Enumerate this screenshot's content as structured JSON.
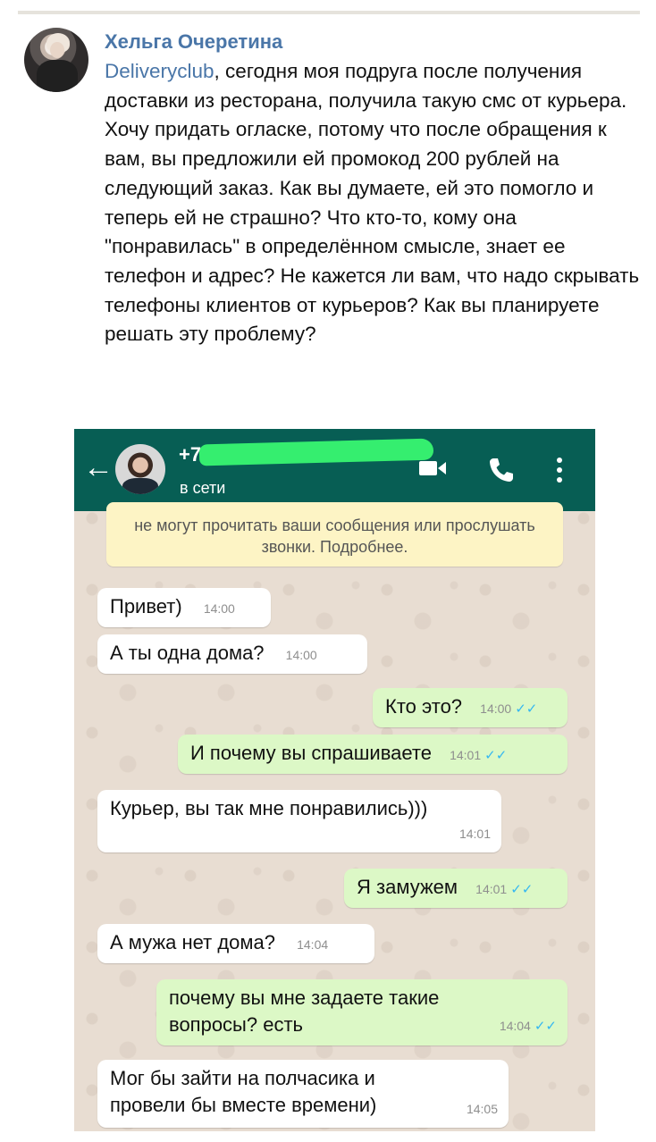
{
  "post": {
    "author": "Хельга Очеретина",
    "mention": "Deliveryclub",
    "text": ", сегодня моя подруга после получения доставки из ресторана, получила такую смс от курьера. Хочу придать огласке, потому что после обращения к вам, вы предложили ей промокод 200 рублей на следующий заказ. Как вы думаете, ей это помогло и теперь ей не страшно? Что кто-то, кому она \"понравилась\" в определённом смысле, знает ее телефон и адрес? Не кажется ли вам, что надо скрывать телефоны клиентов от курьеров? Как вы планируете решать эту проблему?"
  },
  "chat": {
    "header": {
      "contact": "+7",
      "status": "в сети"
    },
    "encryption_note": "не могут прочитать ваши сообщения или прослушать звонки. Подробнее.",
    "messages": [
      {
        "dir": "in",
        "text": "Привет)",
        "time": "14:00"
      },
      {
        "dir": "in",
        "text": "А ты одна дома?",
        "time": "14:00"
      },
      {
        "dir": "out",
        "text": "Кто это?",
        "time": "14:00"
      },
      {
        "dir": "out",
        "text": "И почему вы спрашиваете",
        "time": "14:01"
      },
      {
        "dir": "in",
        "text": "Курьер, вы так мне понравились)))",
        "time": "14:01"
      },
      {
        "dir": "out",
        "text": "Я замужем",
        "time": "14:01"
      },
      {
        "dir": "in",
        "text": "А мужа нет дома?",
        "time": "14:04"
      },
      {
        "dir": "out",
        "text": "почему вы мне задаете такие вопросы? есть",
        "time": "14:04"
      },
      {
        "dir": "in",
        "text": "Мог бы зайти на полчасика и провели бы вместе времени)",
        "time": "14:05"
      }
    ],
    "colors": {
      "header": "#075e54",
      "incoming": "#ffffff",
      "outgoing": "#dcf8c6",
      "read_ticks": "#34b7f1",
      "redaction": "#35ee6f"
    }
  }
}
